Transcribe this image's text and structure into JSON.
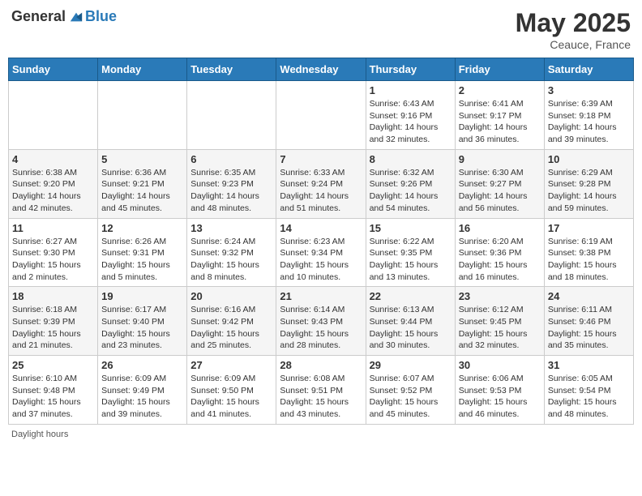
{
  "header": {
    "logo": {
      "text_general": "General",
      "text_blue": "Blue"
    },
    "title": "May 2025",
    "location": "Ceauce, France"
  },
  "calendar": {
    "weekdays": [
      "Sunday",
      "Monday",
      "Tuesday",
      "Wednesday",
      "Thursday",
      "Friday",
      "Saturday"
    ],
    "weeks": [
      [
        {
          "day": "",
          "info": ""
        },
        {
          "day": "",
          "info": ""
        },
        {
          "day": "",
          "info": ""
        },
        {
          "day": "",
          "info": ""
        },
        {
          "day": "1",
          "info": "Sunrise: 6:43 AM\nSunset: 9:16 PM\nDaylight: 14 hours\nand 32 minutes."
        },
        {
          "day": "2",
          "info": "Sunrise: 6:41 AM\nSunset: 9:17 PM\nDaylight: 14 hours\nand 36 minutes."
        },
        {
          "day": "3",
          "info": "Sunrise: 6:39 AM\nSunset: 9:18 PM\nDaylight: 14 hours\nand 39 minutes."
        }
      ],
      [
        {
          "day": "4",
          "info": "Sunrise: 6:38 AM\nSunset: 9:20 PM\nDaylight: 14 hours\nand 42 minutes."
        },
        {
          "day": "5",
          "info": "Sunrise: 6:36 AM\nSunset: 9:21 PM\nDaylight: 14 hours\nand 45 minutes."
        },
        {
          "day": "6",
          "info": "Sunrise: 6:35 AM\nSunset: 9:23 PM\nDaylight: 14 hours\nand 48 minutes."
        },
        {
          "day": "7",
          "info": "Sunrise: 6:33 AM\nSunset: 9:24 PM\nDaylight: 14 hours\nand 51 minutes."
        },
        {
          "day": "8",
          "info": "Sunrise: 6:32 AM\nSunset: 9:26 PM\nDaylight: 14 hours\nand 54 minutes."
        },
        {
          "day": "9",
          "info": "Sunrise: 6:30 AM\nSunset: 9:27 PM\nDaylight: 14 hours\nand 56 minutes."
        },
        {
          "day": "10",
          "info": "Sunrise: 6:29 AM\nSunset: 9:28 PM\nDaylight: 14 hours\nand 59 minutes."
        }
      ],
      [
        {
          "day": "11",
          "info": "Sunrise: 6:27 AM\nSunset: 9:30 PM\nDaylight: 15 hours\nand 2 minutes."
        },
        {
          "day": "12",
          "info": "Sunrise: 6:26 AM\nSunset: 9:31 PM\nDaylight: 15 hours\nand 5 minutes."
        },
        {
          "day": "13",
          "info": "Sunrise: 6:24 AM\nSunset: 9:32 PM\nDaylight: 15 hours\nand 8 minutes."
        },
        {
          "day": "14",
          "info": "Sunrise: 6:23 AM\nSunset: 9:34 PM\nDaylight: 15 hours\nand 10 minutes."
        },
        {
          "day": "15",
          "info": "Sunrise: 6:22 AM\nSunset: 9:35 PM\nDaylight: 15 hours\nand 13 minutes."
        },
        {
          "day": "16",
          "info": "Sunrise: 6:20 AM\nSunset: 9:36 PM\nDaylight: 15 hours\nand 16 minutes."
        },
        {
          "day": "17",
          "info": "Sunrise: 6:19 AM\nSunset: 9:38 PM\nDaylight: 15 hours\nand 18 minutes."
        }
      ],
      [
        {
          "day": "18",
          "info": "Sunrise: 6:18 AM\nSunset: 9:39 PM\nDaylight: 15 hours\nand 21 minutes."
        },
        {
          "day": "19",
          "info": "Sunrise: 6:17 AM\nSunset: 9:40 PM\nDaylight: 15 hours\nand 23 minutes."
        },
        {
          "day": "20",
          "info": "Sunrise: 6:16 AM\nSunset: 9:42 PM\nDaylight: 15 hours\nand 25 minutes."
        },
        {
          "day": "21",
          "info": "Sunrise: 6:14 AM\nSunset: 9:43 PM\nDaylight: 15 hours\nand 28 minutes."
        },
        {
          "day": "22",
          "info": "Sunrise: 6:13 AM\nSunset: 9:44 PM\nDaylight: 15 hours\nand 30 minutes."
        },
        {
          "day": "23",
          "info": "Sunrise: 6:12 AM\nSunset: 9:45 PM\nDaylight: 15 hours\nand 32 minutes."
        },
        {
          "day": "24",
          "info": "Sunrise: 6:11 AM\nSunset: 9:46 PM\nDaylight: 15 hours\nand 35 minutes."
        }
      ],
      [
        {
          "day": "25",
          "info": "Sunrise: 6:10 AM\nSunset: 9:48 PM\nDaylight: 15 hours\nand 37 minutes."
        },
        {
          "day": "26",
          "info": "Sunrise: 6:09 AM\nSunset: 9:49 PM\nDaylight: 15 hours\nand 39 minutes."
        },
        {
          "day": "27",
          "info": "Sunrise: 6:09 AM\nSunset: 9:50 PM\nDaylight: 15 hours\nand 41 minutes."
        },
        {
          "day": "28",
          "info": "Sunrise: 6:08 AM\nSunset: 9:51 PM\nDaylight: 15 hours\nand 43 minutes."
        },
        {
          "day": "29",
          "info": "Sunrise: 6:07 AM\nSunset: 9:52 PM\nDaylight: 15 hours\nand 45 minutes."
        },
        {
          "day": "30",
          "info": "Sunrise: 6:06 AM\nSunset: 9:53 PM\nDaylight: 15 hours\nand 46 minutes."
        },
        {
          "day": "31",
          "info": "Sunrise: 6:05 AM\nSunset: 9:54 PM\nDaylight: 15 hours\nand 48 minutes."
        }
      ]
    ]
  },
  "footer": {
    "note": "Daylight hours"
  }
}
